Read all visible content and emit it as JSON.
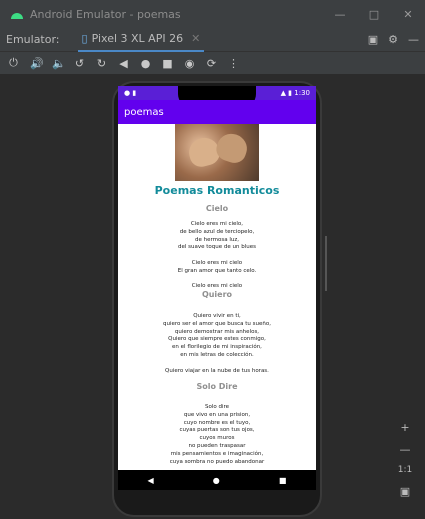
{
  "window": {
    "title": "Android Emulator - poemas",
    "buttons": [
      "—",
      "□",
      "✕"
    ]
  },
  "tabbar": {
    "label": "Emulator:",
    "tab_label": "Pixel 3 XL API 26",
    "tab_close": "✕"
  },
  "toolbar_icons": [
    "power-icon",
    "volume-up-icon",
    "volume-down-icon",
    "rotate-left-icon",
    "rotate-right-icon",
    "back-icon",
    "home-icon",
    "overview-icon",
    "camera-icon",
    "replay-icon",
    "more-icon"
  ],
  "device": {
    "status_time": "1:30",
    "appbar_title": "poemas",
    "main_title": "Poemas Romanticos",
    "sections": [
      {
        "title": "Cielo",
        "lines": [
          "Cielo eres mi cielo,",
          "de bello azul de terciopelo,",
          "de hermosa luz,",
          "del suave toque de un blues",
          "",
          "Cielo eres mi cielo",
          "El gran amor que tanto celo.",
          "",
          "Cielo eres mi cielo"
        ]
      },
      {
        "title": "Quiero",
        "lines": [
          "Quiero vivir en ti,",
          "quiero ser el amor que busca tu sueño,",
          "quiero demostrar mis anhelos,",
          "Quiero que siempre estes conmigo,",
          "en el florilegio de mi inspiración,",
          "en mis letras de colección.",
          "",
          "Quiero viajar en la nube de tus horas."
        ]
      },
      {
        "title": "Solo Dire",
        "lines": [
          "Solo dire",
          "que vivo en una prision,",
          "cuyo nombre es el tuyo,",
          "cuyas puertas son tus ojos,",
          "cuyos muros",
          "no pueden traspasar",
          "mis pensamientos e imaginación,",
          "cuya sombra no puedo abandonar"
        ]
      }
    ]
  },
  "sidebar": {
    "zoom_in": "+",
    "zoom_out": "—",
    "ratio": "1:1"
  }
}
